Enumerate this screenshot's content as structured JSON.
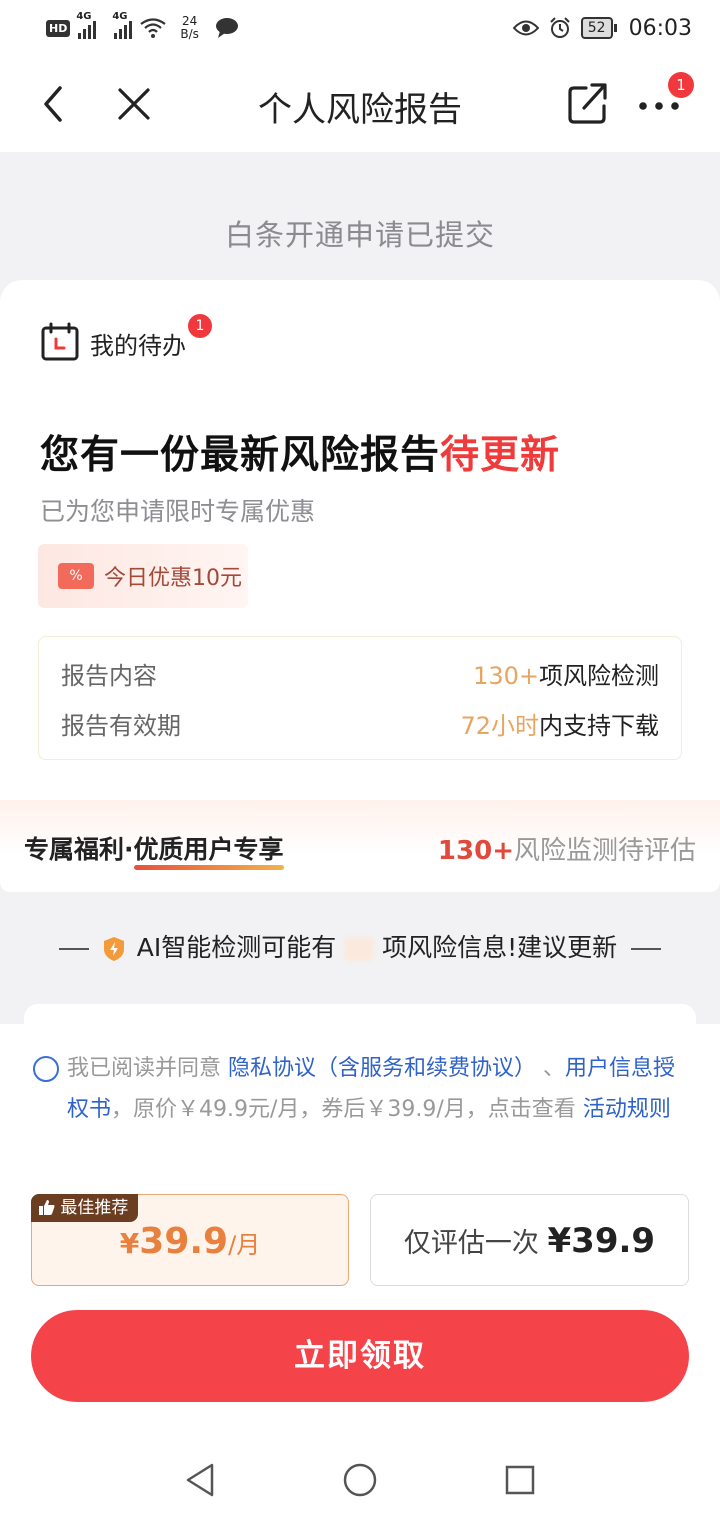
{
  "status_bar": {
    "hd": "HD",
    "net1": "4G",
    "net2": "4G",
    "speed_value": "24",
    "speed_unit": "B/s",
    "battery": "52",
    "time": "06:03"
  },
  "nav": {
    "title": "个人风险报告",
    "more_badge": "1"
  },
  "submitted_text": "白条开通申请已提交",
  "todo": {
    "label": "我的待办",
    "badge": "1"
  },
  "headline": {
    "main": "您有一份最新风险报告",
    "highlight": "待更新"
  },
  "subline": "已为您申请限时专属优惠",
  "coupon": {
    "icon_text": "%",
    "text": "今日优惠10元"
  },
  "report_info": {
    "rows": [
      {
        "label": "报告内容",
        "highlight": "130+",
        "value": "项风险检测"
      },
      {
        "label": "报告有效期",
        "highlight": "72小时",
        "value": "内支持下载"
      }
    ]
  },
  "benefit": {
    "prefix": "专属福利·",
    "underlined": "优质用户专享",
    "right_num": "130+",
    "right_text": "风险监测待评估"
  },
  "ai_notice": {
    "before": "AI智能检测可能有",
    "after": "项风险信息!建议更新"
  },
  "agreement": {
    "lead": "我已阅读并同意 ",
    "link1": "隐私协议（含服务和续费协议）",
    "sep": " 、",
    "link2": "用户信息授权书",
    "mid": "，原价￥49.9元/月，券后￥39.9/月，点击查看 ",
    "link3": "活动规则"
  },
  "plans": {
    "best": {
      "tag": "最佳推荐",
      "yen": "¥",
      "price": "39.9",
      "period": "/月"
    },
    "once": {
      "label": "仅评估一次 ",
      "price": "¥39.9"
    }
  },
  "cta_label": "立即领取",
  "colors": {
    "accent_red": "#f5434a",
    "link_blue": "#2f63c9",
    "highlight_orange": "#e8a560"
  }
}
